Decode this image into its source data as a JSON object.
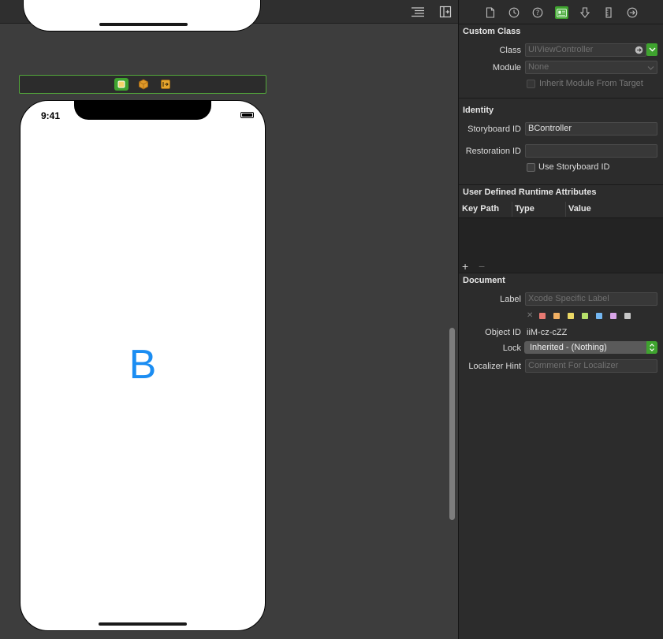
{
  "canvas": {
    "phone": {
      "status_time": "9:41",
      "center_label": "B"
    }
  },
  "inspector": {
    "custom_class": {
      "title": "Custom Class",
      "class_label": "Class",
      "class_placeholder": "UIViewController",
      "module_label": "Module",
      "module_placeholder": "None",
      "inherit_label": "Inherit Module From Target"
    },
    "identity": {
      "title": "Identity",
      "storyboard_id_label": "Storyboard ID",
      "storyboard_id_value": "BController",
      "restoration_id_label": "Restoration ID",
      "restoration_id_value": "",
      "use_storyboard_id_label": "Use Storyboard ID"
    },
    "runtime_attributes": {
      "title": "User Defined Runtime Attributes",
      "columns": [
        "Key Path",
        "Type",
        "Value"
      ],
      "add_symbol": "+",
      "remove_symbol": "−"
    },
    "document": {
      "title": "Document",
      "label_label": "Label",
      "label_placeholder": "Xcode Specific Label",
      "clear_color_symbol": "✕",
      "label_colors": [
        "#e87a72",
        "#f2b063",
        "#ebd865",
        "#b7e06a",
        "#74b7f2",
        "#d9a5e8",
        "#c7c7c7"
      ],
      "object_id_label": "Object ID",
      "object_id_value": "iiM-cz-cZZ",
      "lock_label": "Lock",
      "lock_value": "Inherited - (Nothing)",
      "localizer_hint_label": "Localizer Hint",
      "localizer_hint_placeholder": "Comment For Localizer"
    }
  },
  "colors": {
    "accent_green": "#3fa32f",
    "label_blue": "#1b8df2"
  }
}
